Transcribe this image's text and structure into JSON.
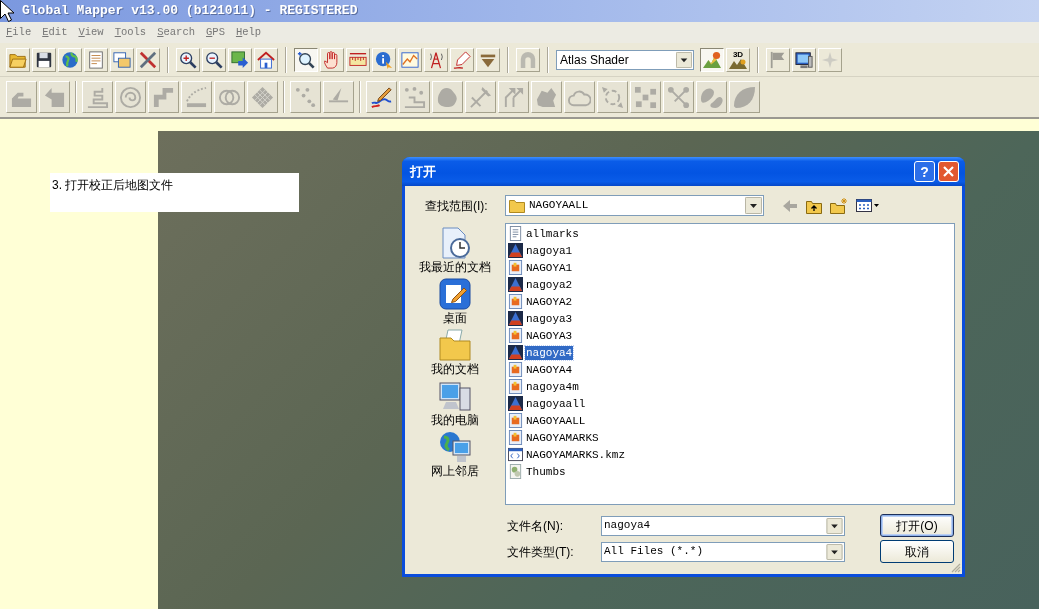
{
  "window": {
    "title": "Global Mapper v13.00 (b121011) - REGISTERED"
  },
  "menu": [
    "File",
    "Edit",
    "View",
    "Tools",
    "Search",
    "GPS",
    "Help"
  ],
  "main_toolbar": {
    "buttons": [
      {
        "selected": false,
        "disabled": false
      },
      {
        "selected": false,
        "disabled": false
      },
      {
        "selected": false,
        "disabled": false
      },
      {
        "selected": false,
        "disabled": false
      },
      {
        "selected": false,
        "disabled": false
      },
      {
        "selected": false,
        "disabled": false
      },
      {
        "selected": false,
        "disabled": false
      },
      {
        "selected": false,
        "disabled": false
      },
      {
        "selected": false,
        "disabled": false
      },
      {
        "selected": false,
        "disabled": false
      },
      {
        "selected": true,
        "disabled": false
      },
      {
        "selected": false,
        "disabled": false
      },
      {
        "selected": false,
        "disabled": false
      },
      {
        "selected": false,
        "disabled": false
      },
      {
        "selected": false,
        "disabled": false
      },
      {
        "selected": false,
        "disabled": false
      },
      {
        "selected": false,
        "disabled": false
      },
      {
        "selected": false,
        "disabled": false
      },
      {
        "selected": false,
        "disabled": true
      }
    ],
    "shader_select": "Atlas Shader",
    "view_buttons": [
      {
        "selected": true
      },
      {
        "selected": false,
        "label": "3D"
      }
    ],
    "extra_buttons": [
      {
        "disabled": true
      },
      {
        "disabled": false
      },
      {
        "disabled": true
      }
    ]
  },
  "digitizer_toolbar": {
    "buttons": [
      {
        "disabled": true
      },
      {
        "disabled": true
      },
      {
        "disabled": true
      },
      {
        "disabled": true
      },
      {
        "disabled": true
      },
      {
        "disabled": true
      },
      {
        "disabled": true
      },
      {
        "disabled": true
      },
      {
        "disabled": true
      },
      {
        "disabled": true
      },
      {
        "disabled": false
      },
      {
        "disabled": true
      },
      {
        "disabled": true
      },
      {
        "disabled": true
      },
      {
        "disabled": true
      },
      {
        "disabled": true
      },
      {
        "disabled": true
      },
      {
        "disabled": true
      },
      {
        "disabled": true
      },
      {
        "disabled": true
      },
      {
        "disabled": true
      },
      {
        "disabled": true
      }
    ]
  },
  "map": {
    "note": "3. 打开校正后地图文件"
  },
  "dialog": {
    "title": "打开",
    "help_button": "?",
    "look_in": {
      "label": "查找范围(I):",
      "value": "NAGOYAALL"
    },
    "nav_buttons": [
      {
        "disabled": true
      },
      {
        "disabled": false
      },
      {
        "disabled": false
      },
      {
        "disabled": false
      }
    ],
    "places": [
      {
        "label": "我最近的文档",
        "kind": "recent"
      },
      {
        "label": "桌面",
        "kind": "desktop"
      },
      {
        "label": "我的文档",
        "kind": "documents"
      },
      {
        "label": "我的电脑",
        "kind": "computer"
      },
      {
        "label": "网上邻居",
        "kind": "network"
      }
    ],
    "files": [
      {
        "name": "allmarks",
        "kind": "text",
        "selected": false
      },
      {
        "name": "nagoya1",
        "kind": "workspace",
        "selected": false
      },
      {
        "name": "NAGOYA1",
        "kind": "image",
        "selected": false
      },
      {
        "name": "nagoya2",
        "kind": "workspace",
        "selected": false
      },
      {
        "name": "NAGOYA2",
        "kind": "image",
        "selected": false
      },
      {
        "name": "nagoya3",
        "kind": "workspace",
        "selected": false
      },
      {
        "name": "NAGOYA3",
        "kind": "image",
        "selected": false
      },
      {
        "name": "nagoya4",
        "kind": "workspace",
        "selected": true
      },
      {
        "name": "NAGOYA4",
        "kind": "image",
        "selected": false
      },
      {
        "name": "nagoya4m",
        "kind": "image",
        "selected": false
      },
      {
        "name": "nagoyaall",
        "kind": "workspace",
        "selected": false
      },
      {
        "name": "NAGOYAALL",
        "kind": "image",
        "selected": false
      },
      {
        "name": "NAGOYAMARKS",
        "kind": "image",
        "selected": false
      },
      {
        "name": "NAGOYAMARKS.kmz",
        "kind": "web",
        "selected": false
      },
      {
        "name": "Thumbs",
        "kind": "thumbs",
        "selected": false
      }
    ],
    "file_name": {
      "label": "文件名(N):",
      "value": "nagoya4"
    },
    "file_type": {
      "label": "文件类型(T):",
      "value": "All Files (*.*)"
    },
    "buttons": [
      {
        "label": "打开(O)",
        "default": true
      },
      {
        "label": "取消",
        "default": false
      }
    ]
  }
}
